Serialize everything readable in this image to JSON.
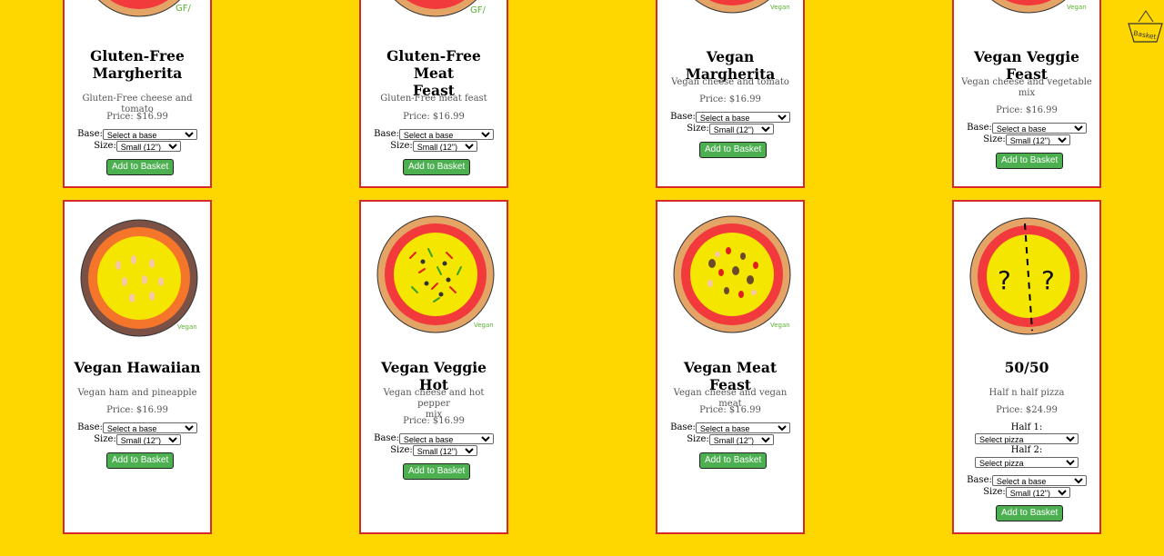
{
  "base_placeholder": "Select a base",
  "size_default": "Small (12\")",
  "base_label": "Base:",
  "size_label": "Size:",
  "add_label": "Add to Basket",
  "basket_label": "Basket",
  "row1": [
    {
      "name": "Gluten-Free Margherita",
      "name_l1": "Gluten-Free",
      "name_l2": "Margherita",
      "desc": "Gluten-Free cheese and tomato",
      "price": "Price: $16.99",
      "badge": "GF"
    },
    {
      "name": "Gluten-Free Meat Feast",
      "name_l1": "Gluten-Free Meat",
      "name_l2": "Feast",
      "desc": "Gluten-Free meat feast",
      "price": "Price: $16.99",
      "badge": "GF"
    },
    {
      "name": "Vegan Margherita",
      "desc": "Vegan cheese and tomato",
      "price": "Price: $16.99",
      "badge": "Vegan"
    },
    {
      "name": "Vegan Veggie Feast",
      "desc_l1": "Vegan cheese and vegetable",
      "desc_l2": "mix",
      "price": "Price: $16.99",
      "badge": "Vegan"
    }
  ],
  "row2": [
    {
      "name": "Vegan Hawaiian",
      "desc": "Vegan ham and pineapple",
      "price": "Price: $16.99",
      "badge": "Vegan"
    },
    {
      "name": "Vegan Veggie Hot",
      "desc_l1": "Vegan cheese and hot pepper",
      "desc_l2": "mix",
      "price": "Price: $16.99",
      "badge": "Vegan"
    },
    {
      "name": "Vegan Meat Feast",
      "desc": "Vegan cheese and vegan meat",
      "price": "Price: $16.99",
      "badge": "Vegan"
    },
    {
      "name": "50/50",
      "desc": "Half n half pizza",
      "price": "Price: $24.99",
      "half1": "Half 1:",
      "half2": "Half 2:",
      "select_pizza": "Select pizza"
    }
  ]
}
